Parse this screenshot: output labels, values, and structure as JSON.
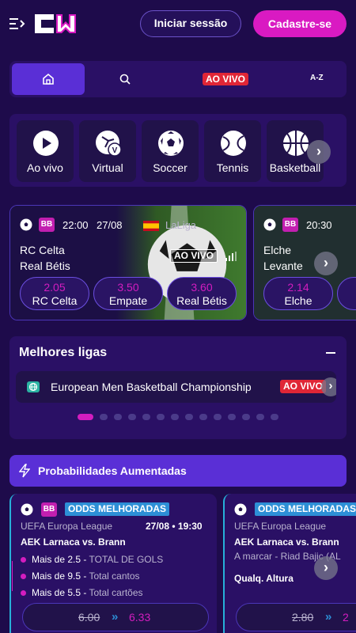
{
  "header": {
    "login_label": "Iniciar sessão",
    "signup_label": "Cadastre-se",
    "menu_icon": "menu-collapse-icon",
    "logo_icon": "cw-logo"
  },
  "nav": {
    "home_icon": "home-icon",
    "search_icon": "search-icon",
    "live_label": "AO VIVO",
    "az_label": "A-Z"
  },
  "sports": [
    {
      "label": "Ao vivo",
      "icon": "play-icon"
    },
    {
      "label": "Virtual",
      "icon": "virtual-icon"
    },
    {
      "label": "Soccer",
      "icon": "soccer-icon"
    },
    {
      "label": "Tennis",
      "icon": "tennis-icon"
    },
    {
      "label": "Basketball",
      "icon": "basketball-icon"
    }
  ],
  "events": [
    {
      "badge": "BB",
      "time": "22:00",
      "date": "27/08",
      "league": "LaLiga",
      "home": "RC Celta",
      "away": "Real Bétis",
      "live": "AO VIVO",
      "odds": [
        {
          "value": "2.05",
          "name": "RC Celta"
        },
        {
          "value": "3.50",
          "name": "Empate"
        },
        {
          "value": "3.60",
          "name": "Real Bétis"
        }
      ]
    },
    {
      "badge": "BB",
      "time": "20:30",
      "home": "Elche",
      "away": "Levante",
      "odds": [
        {
          "value": "2.14",
          "name": "Elche"
        }
      ]
    }
  ],
  "best_leagues": {
    "title": "Melhores ligas",
    "item": {
      "name": "European Men Basketball Championship",
      "live": "AO VIVO"
    }
  },
  "boost": {
    "title": "Probabilidades Aumentadas",
    "cards": [
      {
        "badge": "BB",
        "tag": "ODDS MELHORADAS",
        "league": "UEFA Europa League",
        "datetime": "27/08 • 19:30",
        "match": "AEK Larnaca vs. Brann",
        "selections": [
          {
            "pick": "Mais de 2.5",
            "market": "TOTAL DE GOLS"
          },
          {
            "pick": "Mais de 9.5",
            "market": "Total cantos"
          },
          {
            "pick": "Mais de 5.5",
            "market": "Total cartões"
          }
        ],
        "old_odd": "6.00",
        "new_odd": "6.33"
      },
      {
        "tag": "ODDS MELHORADAS",
        "league": "UEFA Europa League",
        "match": "AEK Larnaca vs. Brann",
        "line2": "A marcar - Riad Bajic (AL",
        "line3": "Qualq. Altura",
        "old_odd": "2.80",
        "new_odd": "2"
      }
    ]
  },
  "colors": {
    "accent": "#d91ac2",
    "nav_active": "#5a2fd6",
    "live": "#e02636",
    "boost_tag": "#2d8fd6"
  }
}
